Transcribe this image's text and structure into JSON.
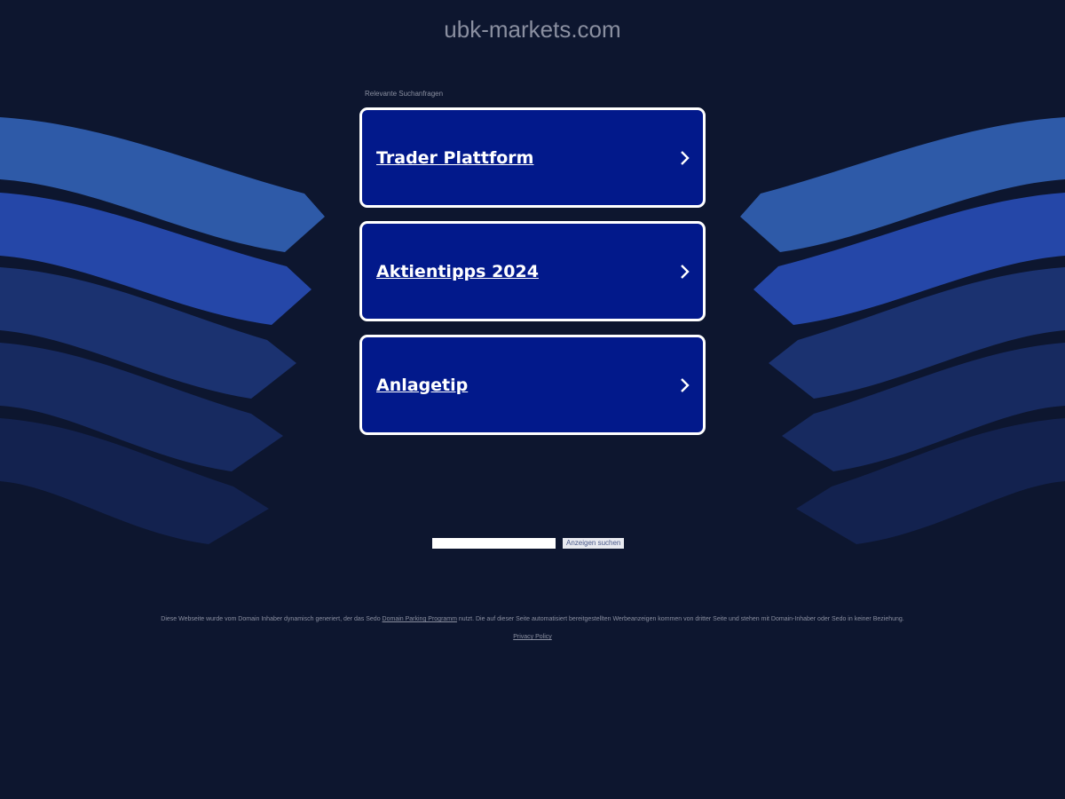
{
  "header": {
    "domain": "ubk-markets.com"
  },
  "related": {
    "label": "Relevante Suchanfragen",
    "links": [
      {
        "label": "Trader Plattform"
      },
      {
        "label": "Aktientipps 2024"
      },
      {
        "label": "Anlagetip"
      }
    ]
  },
  "search": {
    "value": "",
    "button_label": "Anzeigen suchen"
  },
  "footer": {
    "disclaimer_before": "Diese Webseite wurde vom Domain Inhaber dynamisch generiert, der das Sedo ",
    "disclaimer_link": "Domain Parking Programm",
    "disclaimer_after": " nutzt. Die auf dieser Seite automatisiert bereitgestellten Werbeanzeigen kommen von dritter Seite und stehen mit Domain-Inhaber oder Sedo in keiner Beziehung.",
    "privacy_label": "Privacy Policy"
  },
  "colors": {
    "background": "#0d162f",
    "card": "#02198b",
    "card_border": "#ffffff",
    "wave_1": "#2e5aa8",
    "wave_2": "#2547a8",
    "wave_3": "#1b3270",
    "wave_4": "#172a60",
    "wave_5": "#13224f",
    "muted_text": "#8a8fa0"
  },
  "icons": {
    "link_arrow": "chevron-right-icon"
  }
}
